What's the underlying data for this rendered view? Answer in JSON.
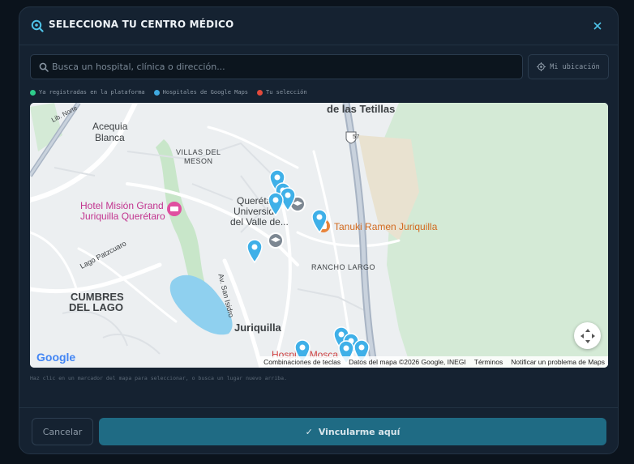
{
  "header": {
    "title": "SELECCIONA TU CENTRO MÉDICO",
    "close_symbol": "×"
  },
  "search": {
    "placeholder": "Busca un hospital, clínica o dirección...",
    "value": ""
  },
  "location_button": {
    "label": "Mi ubicación"
  },
  "legend": [
    {
      "label": "Ya registradas en la plataforma",
      "color": "#2ecc8b"
    },
    {
      "label": "Hospitales de Google Maps",
      "color": "#3fa9e0"
    },
    {
      "label": "Tu selección",
      "color": "#e2493b"
    }
  ],
  "map": {
    "labels": {
      "tetillas": "de las Tetillas",
      "acequia1": "Acequia",
      "acequia2": "Blanca",
      "villas1": "VILLAS DEL",
      "villas2": "MESON",
      "hotel1": "Hotel Misión Grand",
      "hotel2": "Juriquilla Querétaro",
      "univ1": "Queréta",
      "univ2": "Universid",
      "univ3": "del Valle de...",
      "tanuki": "Tanuki Ramen Juriquilla",
      "rancho": "RANCHO LARGO",
      "lago": "Lago Patzcuaro",
      "cumbres1": "CUMBRES",
      "cumbres2": "DEL LAGO",
      "sanisidro": "Av. San Isidro",
      "juriquilla": "Juriquilla",
      "hospital": "Hospital Mosca",
      "libnorte": "Lib. Norte",
      "highway": "57"
    },
    "google_logo": "Google",
    "attribution": {
      "shortcuts": "Combinaciones de teclas",
      "data": "Datos del mapa ©2026 Google, INEGI",
      "terms": "Términos",
      "report": "Notificar un problema de Maps"
    }
  },
  "hint": "Haz clic en un marcador del mapa para seleccionar, o busca un lugar nuevo arriba.",
  "footer": {
    "cancel_label": "Cancelar",
    "confirm_label": "Vincularme aquí",
    "confirm_icon": "✓"
  }
}
